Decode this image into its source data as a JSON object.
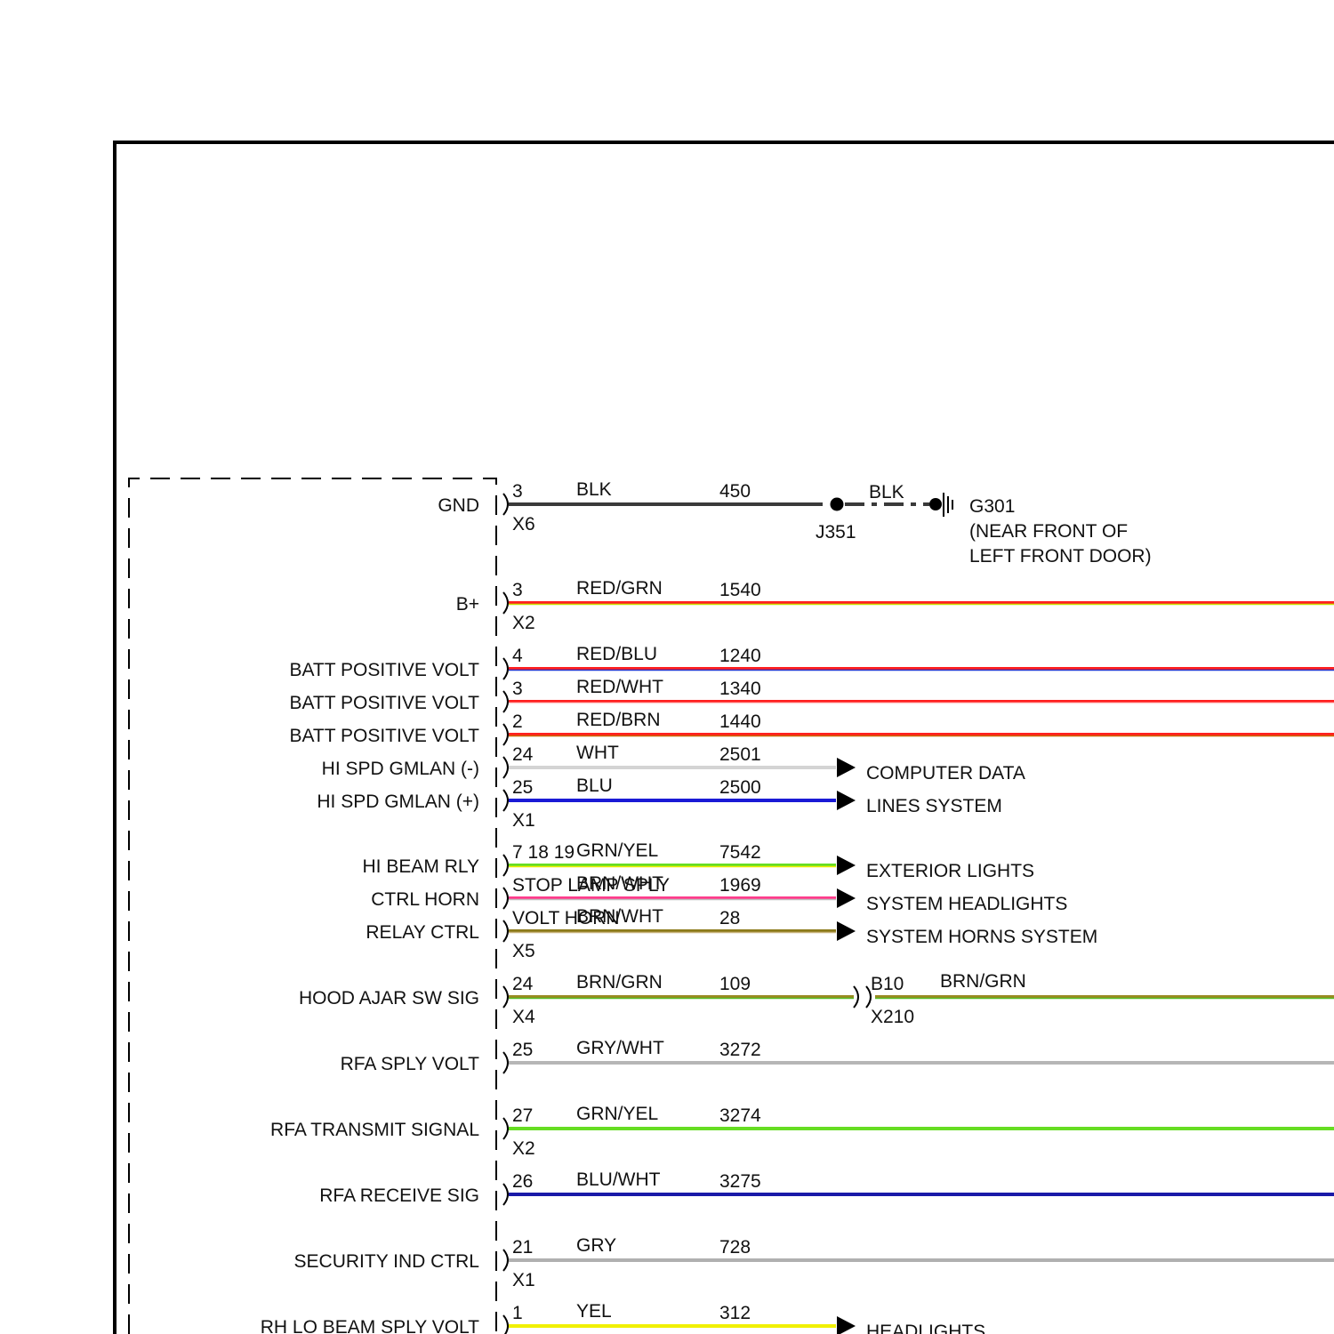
{
  "circuits": [
    {
      "label": "GND",
      "pin": "3",
      "color_name": "BLK",
      "circuit": "450",
      "colors": [
        "#3a3a3a"
      ],
      "connector": "X6"
    },
    {
      "label": "B+",
      "pin": "3",
      "color_name": "RED/GRN",
      "circuit": "1540",
      "colors": [
        "#ff2020",
        "#c8e000"
      ],
      "connector": "X2"
    },
    {
      "label": "BATT POSITIVE VOLT",
      "pin": "4",
      "color_name": "RED/BLU",
      "circuit": "1240",
      "colors": [
        "#ff2020",
        "#2233cc"
      ]
    },
    {
      "label": "BATT POSITIVE VOLT",
      "pin": "3",
      "color_name": "RED/WHT",
      "circuit": "1340",
      "colors": [
        "#ff2020",
        "#ffd0d0"
      ]
    },
    {
      "label": "BATT POSITIVE VOLT",
      "pin": "2",
      "color_name": "RED/BRN",
      "circuit": "1440",
      "colors": [
        "#ff2020",
        "#cc6600"
      ]
    },
    {
      "label": "HI SPD GMLAN (-)",
      "pin": "24",
      "color_name": "WHT",
      "circuit": "2501",
      "colors": [
        "#d4d4d4"
      ],
      "dest": "COMPUTER DATA"
    },
    {
      "label": "HI SPD GMLAN (+)",
      "pin": "25",
      "color_name": "BLU",
      "circuit": "2500",
      "colors": [
        "#1a1ad6"
      ],
      "dest": "LINES SYSTEM",
      "connector": "X1"
    },
    {
      "label": "HI BEAM RLY",
      "pin": "7 18 19",
      "color_name": "GRN/YEL",
      "circuit": "7542",
      "colors": [
        "#66dd22",
        "#eeee00"
      ],
      "dest": "EXTERIOR LIGHTS"
    },
    {
      "label": "CTRL HORN",
      "pin": "STOP LAMP SPLY",
      "color_name": "BRN/WHT",
      "circuit": "1969",
      "colors": [
        "#ff3c8c",
        "#bfbfbf"
      ],
      "dest": "SYSTEM HEADLIGHTS"
    },
    {
      "label": "RELAY CTRL",
      "pin": "VOLT HORN",
      "color_name": "BRN/WHT",
      "circuit": "28",
      "colors": [
        "#8c7a1a",
        "#c7b27a"
      ],
      "dest": "SYSTEM HORNS SYSTEM",
      "connector": "X5"
    },
    {
      "label": "HOOD AJAR SW SIG",
      "pin": "24",
      "color_name": "BRN/GRN",
      "circuit": "109",
      "colors": [
        "#9a8a22",
        "#55bb22"
      ],
      "connector": "X4"
    },
    {
      "label": "RFA SPLY VOLT",
      "pin": "25",
      "color_name": "GRY/WHT",
      "circuit": "3272",
      "colors": [
        "#b6b6b6"
      ]
    },
    {
      "label": "RFA TRANSMIT SIGNAL",
      "pin": "27",
      "color_name": "GRN/YEL",
      "circuit": "3274",
      "colors": [
        "#66dd22"
      ],
      "connector": "X2"
    },
    {
      "label": "RFA RECEIVE SIG",
      "pin": "26",
      "color_name": "BLU/WHT",
      "circuit": "3275",
      "colors": [
        "#1a1aa8"
      ]
    },
    {
      "label": "SECURITY IND CTRL",
      "pin": "21",
      "color_name": "GRY",
      "circuit": "728",
      "colors": [
        "#b0b0b0"
      ],
      "connector": "X1"
    },
    {
      "label": "RH LO BEAM SPLY VOLT",
      "pin": "1",
      "color_name": "YEL",
      "circuit": "312",
      "colors": [
        "#f0f000"
      ],
      "dest": "HEADLIGHTS"
    }
  ],
  "ground": {
    "splice": "J351",
    "color_name": "BLK",
    "ground_id": "G301",
    "location_line1": "(NEAR FRONT OF",
    "location_line2": "LEFT FRONT DOOR)"
  },
  "inline": {
    "pin": "B10",
    "color_name": "BRN/GRN",
    "connector": "X210"
  }
}
